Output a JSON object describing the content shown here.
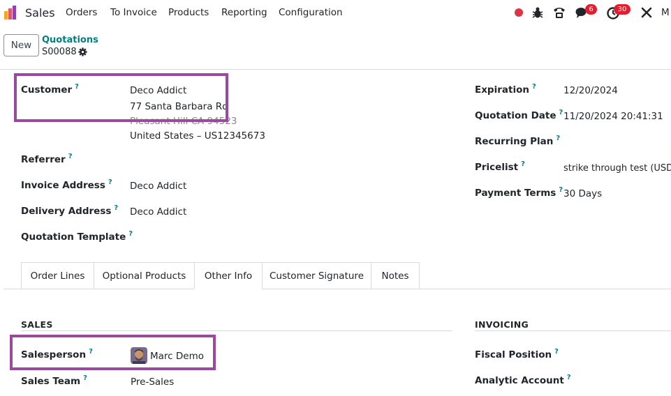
{
  "navbar": {
    "app_name": "Sales",
    "menu": [
      "Orders",
      "To Invoice",
      "Products",
      "Reporting",
      "Configuration"
    ],
    "chat_badge": "6",
    "activity_badge": "30",
    "user_initial": "M"
  },
  "control": {
    "new_label": "New",
    "breadcrumb_parent": "Quotations",
    "record_name": "S00088"
  },
  "form": {
    "customer": {
      "label": "Customer",
      "name": "Deco Addict",
      "street": "77 Santa Barbara Rd",
      "city": "Pleasant Hill CA 94523",
      "country": "United States – US12345673"
    },
    "referrer_label": "Referrer",
    "invoice_address": {
      "label": "Invoice Address",
      "value": "Deco Addict"
    },
    "delivery_address": {
      "label": "Delivery Address",
      "value": "Deco Addict"
    },
    "quotation_template_label": "Quotation Template",
    "expiration": {
      "label": "Expiration",
      "value": "12/20/2024"
    },
    "quotation_date": {
      "label": "Quotation Date",
      "value": "11/20/2024 20:41:31"
    },
    "recurring_plan_label": "Recurring Plan",
    "pricelist": {
      "label": "Pricelist",
      "value": "strike through test (USD)"
    },
    "payment_terms": {
      "label": "Payment Terms",
      "value": "30 Days"
    },
    "help_mark": "?"
  },
  "tabs": [
    "Order Lines",
    "Optional Products",
    "Other Info",
    "Customer Signature",
    "Notes"
  ],
  "other_info": {
    "sales_title": "SALES",
    "invoicing_title": "INVOICING",
    "salesperson": {
      "label": "Salesperson",
      "value": "Marc Demo"
    },
    "sales_team": {
      "label": "Sales Team",
      "value": "Pre-Sales"
    },
    "fiscal_position_label": "Fiscal Position",
    "analytic_account_label": "Analytic Account"
  },
  "colors": {
    "accent": "#017e84",
    "highlight": "#9a4a9c",
    "badge": "#e11d2e"
  }
}
